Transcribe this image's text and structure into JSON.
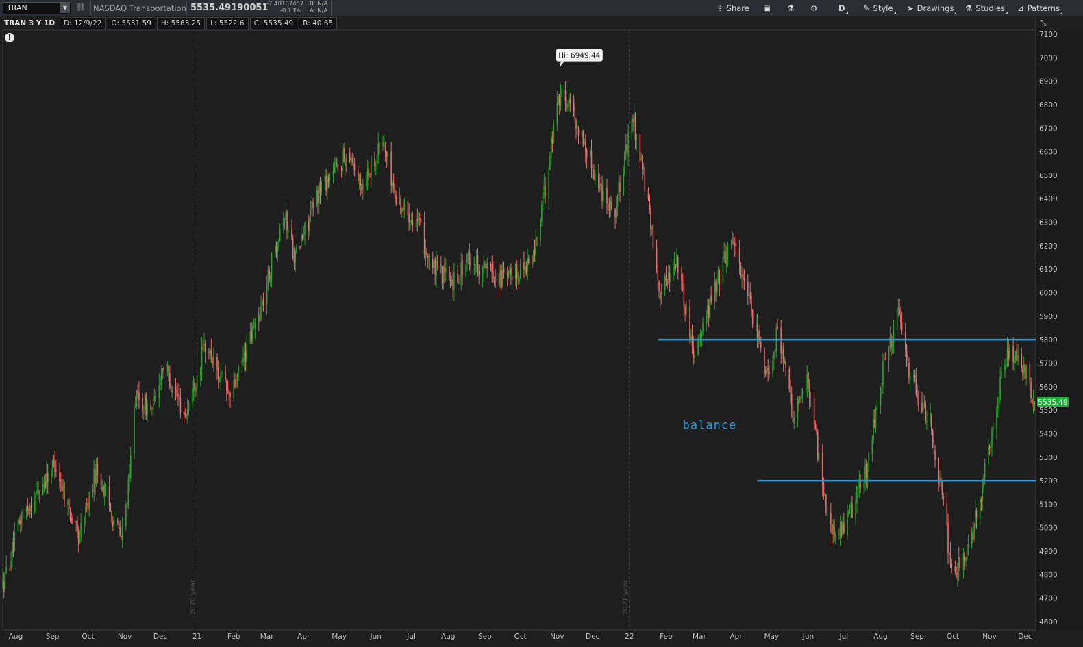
{
  "header": {
    "symbol": "TRAN",
    "description": "NASDAQ Transportation",
    "last_price": "5535.49190051",
    "change": "-7.40107457",
    "change_pct": "-0.13%",
    "bid": "B: N/A",
    "ask": "A: N/A",
    "buttons": {
      "share": "Share",
      "aggregation": "D",
      "style": "Style",
      "drawings": "Drawings",
      "studies": "Studies",
      "patterns": "Patterns"
    }
  },
  "infobar": {
    "symbol_period": "TRAN 3 Y 1D",
    "date": "D: 12/9/22",
    "open": "O: 5531.59",
    "high": "H: 5563.25",
    "low": "L: 5522.6",
    "close": "C: 5535.49",
    "range": "R: 40.65"
  },
  "colors": {
    "up": "#2fa02f",
    "down": "#e86d6d",
    "horizontal_line": "#1c9ee6",
    "background": "#1e1e1e",
    "price_tag": "#1fae3a"
  },
  "chart_data": {
    "type": "candlestick",
    "y_axis": {
      "min": 4600,
      "max": 7100,
      "ticks": [
        4600,
        4700,
        4800,
        4900,
        5000,
        5100,
        5200,
        5300,
        5400,
        5500,
        5600,
        5700,
        5800,
        5900,
        6000,
        6100,
        6200,
        6300,
        6400,
        6500,
        6600,
        6700,
        6800,
        6900,
        7000,
        7100
      ]
    },
    "x_axis": {
      "range": [
        "2020-07-21",
        "2022-12-10"
      ],
      "labels": [
        {
          "d": "2020-08-01",
          "t": "Aug"
        },
        {
          "d": "2020-09-01",
          "t": "Sep"
        },
        {
          "d": "2020-10-01",
          "t": "Oct"
        },
        {
          "d": "2020-11-01",
          "t": "Nov"
        },
        {
          "d": "2020-12-01",
          "t": "Dec"
        },
        {
          "d": "2021-01-01",
          "t": "21"
        },
        {
          "d": "2021-02-01",
          "t": "Feb"
        },
        {
          "d": "2021-03-01",
          "t": "Mar"
        },
        {
          "d": "2021-04-01",
          "t": "Apr"
        },
        {
          "d": "2021-05-01",
          "t": "May"
        },
        {
          "d": "2021-06-01",
          "t": "Jun"
        },
        {
          "d": "2021-07-01",
          "t": "Jul"
        },
        {
          "d": "2021-08-01",
          "t": "Aug"
        },
        {
          "d": "2021-09-01",
          "t": "Sep"
        },
        {
          "d": "2021-10-01",
          "t": "Oct"
        },
        {
          "d": "2021-11-01",
          "t": "Nov"
        },
        {
          "d": "2021-12-01",
          "t": "Dec"
        },
        {
          "d": "2022-01-01",
          "t": "22"
        },
        {
          "d": "2022-02-01",
          "t": "Feb"
        },
        {
          "d": "2022-03-01",
          "t": "Mar"
        },
        {
          "d": "2022-04-01",
          "t": "Apr"
        },
        {
          "d": "2022-05-01",
          "t": "May"
        },
        {
          "d": "2022-06-01",
          "t": "Jun"
        },
        {
          "d": "2022-07-01",
          "t": "Jul"
        },
        {
          "d": "2022-08-01",
          "t": "Aug"
        },
        {
          "d": "2022-09-01",
          "t": "Sep"
        },
        {
          "d": "2022-10-01",
          "t": "Oct"
        },
        {
          "d": "2022-11-01",
          "t": "Nov"
        },
        {
          "d": "2022-12-01",
          "t": "Dec"
        }
      ]
    },
    "year_markers": [
      {
        "d": "2021-01-01",
        "label": "2020 year"
      },
      {
        "d": "2022-01-01",
        "label": "2021 year"
      }
    ],
    "price_path": [
      {
        "d": "2020-07-21",
        "v": 4750
      },
      {
        "d": "2020-08-06",
        "v": 5050
      },
      {
        "d": "2020-08-20",
        "v": 5150
      },
      {
        "d": "2020-09-03",
        "v": 5280
      },
      {
        "d": "2020-09-23",
        "v": 4950
      },
      {
        "d": "2020-10-08",
        "v": 5250
      },
      {
        "d": "2020-10-29",
        "v": 4950
      },
      {
        "d": "2020-11-05",
        "v": 5200
      },
      {
        "d": "2020-11-09",
        "v": 5550
      },
      {
        "d": "2020-11-25",
        "v": 5500
      },
      {
        "d": "2020-12-03",
        "v": 5700
      },
      {
        "d": "2020-12-22",
        "v": 5480
      },
      {
        "d": "2021-01-08",
        "v": 5780
      },
      {
        "d": "2021-01-29",
        "v": 5550
      },
      {
        "d": "2021-02-25",
        "v": 5950
      },
      {
        "d": "2021-03-15",
        "v": 6350
      },
      {
        "d": "2021-03-25",
        "v": 6150
      },
      {
        "d": "2021-04-15",
        "v": 6450
      },
      {
        "d": "2021-05-10",
        "v": 6600
      },
      {
        "d": "2021-05-19",
        "v": 6450
      },
      {
        "d": "2021-06-07",
        "v": 6650
      },
      {
        "d": "2021-06-18",
        "v": 6400
      },
      {
        "d": "2021-07-06",
        "v": 6300
      },
      {
        "d": "2021-07-19",
        "v": 6100
      },
      {
        "d": "2021-08-05",
        "v": 6050
      },
      {
        "d": "2021-08-20",
        "v": 6150
      },
      {
        "d": "2021-09-01",
        "v": 6100
      },
      {
        "d": "2021-09-20",
        "v": 6050
      },
      {
        "d": "2021-10-01",
        "v": 6100
      },
      {
        "d": "2021-10-12",
        "v": 6150
      },
      {
        "d": "2021-10-22",
        "v": 6450
      },
      {
        "d": "2021-11-02",
        "v": 6850
      },
      {
        "d": "2021-11-12",
        "v": 6800
      },
      {
        "d": "2021-11-30",
        "v": 6550
      },
      {
        "d": "2021-12-07",
        "v": 6450
      },
      {
        "d": "2021-12-20",
        "v": 6350
      },
      {
        "d": "2022-01-04",
        "v": 6750
      },
      {
        "d": "2022-01-13",
        "v": 6500
      },
      {
        "d": "2022-01-27",
        "v": 6000
      },
      {
        "d": "2022-02-10",
        "v": 6150
      },
      {
        "d": "2022-02-24",
        "v": 5750
      },
      {
        "d": "2022-03-10",
        "v": 5950
      },
      {
        "d": "2022-03-29",
        "v": 6250
      },
      {
        "d": "2022-04-12",
        "v": 5950
      },
      {
        "d": "2022-04-28",
        "v": 5650
      },
      {
        "d": "2022-05-06",
        "v": 5850
      },
      {
        "d": "2022-05-20",
        "v": 5450
      },
      {
        "d": "2022-05-31",
        "v": 5650
      },
      {
        "d": "2022-06-14",
        "v": 5150
      },
      {
        "d": "2022-06-23",
        "v": 4950
      },
      {
        "d": "2022-07-06",
        "v": 5050
      },
      {
        "d": "2022-07-20",
        "v": 5250
      },
      {
        "d": "2022-08-04",
        "v": 5700
      },
      {
        "d": "2022-08-16",
        "v": 5900
      },
      {
        "d": "2022-08-26",
        "v": 5650
      },
      {
        "d": "2022-09-12",
        "v": 5450
      },
      {
        "d": "2022-09-23",
        "v": 5100
      },
      {
        "d": "2022-09-30",
        "v": 4800
      },
      {
        "d": "2022-10-13",
        "v": 4880
      },
      {
        "d": "2022-10-27",
        "v": 5200
      },
      {
        "d": "2022-11-10",
        "v": 5600
      },
      {
        "d": "2022-11-16",
        "v": 5750
      },
      {
        "d": "2022-11-30",
        "v": 5680
      },
      {
        "d": "2022-12-09",
        "v": 5535
      }
    ],
    "annotations": {
      "high_label": "Hi: 6949.44",
      "high": {
        "d": "2021-11-03",
        "v": 6949.44
      },
      "balance_text": "balance",
      "balance_text_pos": {
        "d": "2022-02-15",
        "v": 5420
      },
      "horizontal_lines": [
        {
          "v": 5800,
          "from": "2022-01-25",
          "to": "2022-12-10"
        },
        {
          "v": 5200,
          "from": "2022-04-19",
          "to": "2022-12-10"
        }
      ],
      "last_price_tag": "5535.49",
      "last_price_value": 5535.49
    }
  }
}
